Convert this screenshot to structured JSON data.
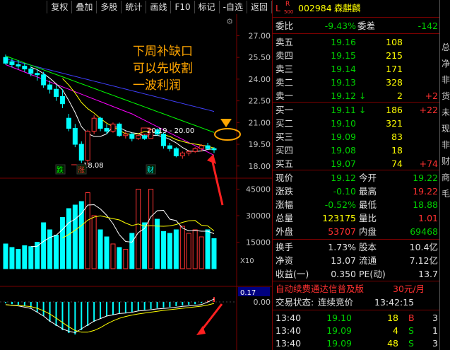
{
  "toolbar": {
    "items": [
      "复权",
      "叠加",
      "多股",
      "统计",
      "画线",
      "F10",
      "标记",
      "-自选",
      "返回"
    ]
  },
  "chart": {
    "price_axis": [
      "27.00",
      "25.50",
      "24.00",
      "22.50",
      "21.00",
      "19.50",
      "18.00"
    ],
    "vol_axis": [
      "45000",
      "30000",
      "15000"
    ],
    "vol_multiplier": "X10",
    "macd_axis": [
      "0.17",
      "0.00"
    ],
    "annotation": [
      "下周补缺口",
      "可以先收割",
      "一波利润"
    ],
    "label_gap": "20.19 - 20.00",
    "label_low": "18.08",
    "marks": [
      "跌",
      "涨",
      "财"
    ],
    "colors": {
      "up": "#ff3333",
      "down": "#00ffff",
      "ma5": "#ffffff",
      "ma10": "#ffff00",
      "ma20": "#ff00ff",
      "ma60": "#00ff00",
      "ma_blue": "#4040ff",
      "annotation": "#ffa500"
    }
  },
  "chart_data": {
    "type": "line",
    "candles": [
      {
        "o": 25.5,
        "h": 25.7,
        "l": 25.0,
        "c": 25.1
      },
      {
        "o": 25.2,
        "h": 25.4,
        "l": 24.8,
        "c": 25.0
      },
      {
        "o": 25.0,
        "h": 25.3,
        "l": 24.7,
        "c": 24.9
      },
      {
        "o": 24.9,
        "h": 25.1,
        "l": 24.5,
        "c": 24.7
      },
      {
        "o": 24.7,
        "h": 24.9,
        "l": 24.2,
        "c": 24.4
      },
      {
        "o": 24.4,
        "h": 24.7,
        "l": 23.9,
        "c": 24.3
      },
      {
        "o": 24.3,
        "h": 24.5,
        "l": 23.4,
        "c": 23.6
      },
      {
        "o": 23.6,
        "h": 23.9,
        "l": 23.0,
        "c": 23.3
      },
      {
        "o": 23.3,
        "h": 23.6,
        "l": 22.5,
        "c": 22.8
      },
      {
        "o": 22.8,
        "h": 23.3,
        "l": 22.0,
        "c": 22.3
      },
      {
        "o": 21.3,
        "h": 21.6,
        "l": 20.4,
        "c": 20.6
      },
      {
        "o": 20.6,
        "h": 20.9,
        "l": 19.3,
        "c": 19.5
      },
      {
        "o": 19.5,
        "h": 19.7,
        "l": 18.2,
        "c": 18.4
      },
      {
        "o": 18.4,
        "h": 20.5,
        "l": 18.1,
        "c": 20.4
      },
      {
        "o": 20.4,
        "h": 21.5,
        "l": 20.2,
        "c": 21.3
      },
      {
        "o": 21.3,
        "h": 21.4,
        "l": 20.4,
        "c": 20.6
      },
      {
        "o": 20.6,
        "h": 20.9,
        "l": 20.2,
        "c": 20.4
      },
      {
        "o": 20.4,
        "h": 21.0,
        "l": 20.3,
        "c": 20.9
      },
      {
        "o": 20.9,
        "h": 21.0,
        "l": 20.0,
        "c": 20.1
      },
      {
        "o": 20.1,
        "h": 20.4,
        "l": 19.9,
        "c": 20.2
      },
      {
        "o": 20.2,
        "h": 20.3,
        "l": 19.7,
        "c": 19.9
      },
      {
        "o": 19.9,
        "h": 20.2,
        "l": 19.8,
        "c": 20.1
      },
      {
        "o": 20.1,
        "h": 20.2,
        "l": 19.8,
        "c": 19.9
      },
      {
        "o": 19.9,
        "h": 20.6,
        "l": 19.9,
        "c": 20.5
      },
      {
        "o": 20.5,
        "h": 20.6,
        "l": 20.1,
        "c": 20.2
      },
      {
        "o": 20.2,
        "h": 20.3,
        "l": 19.2,
        "c": 19.4
      },
      {
        "o": 19.4,
        "h": 19.6,
        "l": 19.0,
        "c": 19.2
      },
      {
        "o": 19.2,
        "h": 19.3,
        "l": 18.6,
        "c": 18.7
      },
      {
        "o": 18.7,
        "h": 19.0,
        "l": 18.5,
        "c": 18.9
      },
      {
        "o": 18.9,
        "h": 19.1,
        "l": 18.7,
        "c": 19.0
      },
      {
        "o": 19.0,
        "h": 19.3,
        "l": 18.9,
        "c": 19.2
      },
      {
        "o": 19.2,
        "h": 19.5,
        "l": 19.0,
        "c": 19.4
      },
      {
        "o": 19.4,
        "h": 19.6,
        "l": 19.1,
        "c": 19.2
      },
      {
        "o": 19.2,
        "h": 19.3,
        "l": 18.9,
        "c": 19.12
      }
    ],
    "volume": [
      14000,
      12000,
      11000,
      13000,
      12500,
      15000,
      26000,
      22000,
      19000,
      29000,
      34000,
      36000,
      38000,
      43000,
      30000,
      22000,
      18000,
      14000,
      12000,
      11000,
      20000,
      45000,
      26000,
      45000,
      28000,
      21000,
      20000,
      22000,
      24000,
      20000,
      22000,
      18000,
      22000,
      17000
    ],
    "macd": [
      -0.05,
      -0.08,
      -0.1,
      -0.15,
      -0.2,
      -0.35,
      -0.5,
      -0.7,
      -0.85,
      -1.0,
      -1.1,
      -1.15,
      -1.0,
      -0.85,
      -0.7,
      -0.6,
      -0.5,
      -0.45,
      -0.4,
      -0.38,
      -0.35,
      -0.3,
      -0.28,
      -0.25,
      -0.22,
      -0.2,
      -0.18,
      -0.15,
      -0.12,
      -0.1,
      -0.08,
      -0.05,
      0.05,
      0.17
    ],
    "ylim": [
      17.5,
      28.0
    ]
  },
  "quote": {
    "header": {
      "L": "L",
      "R": "R",
      "sub": "500",
      "code": "002984",
      "name": "森麒麟"
    },
    "weibi": {
      "label": "委比",
      "pct": "-9.43%",
      "label2": "委差",
      "val": "-142"
    },
    "asks": [
      {
        "label": "卖五",
        "price": "19.16",
        "vol": "108",
        "chg": ""
      },
      {
        "label": "卖四",
        "price": "19.15",
        "vol": "215",
        "chg": ""
      },
      {
        "label": "卖三",
        "price": "19.14",
        "vol": "171",
        "chg": ""
      },
      {
        "label": "卖二",
        "price": "19.13",
        "vol": "328",
        "chg": ""
      },
      {
        "label": "卖一",
        "price": "19.12",
        "vol": "2",
        "chg": "+2"
      }
    ],
    "bids": [
      {
        "label": "买一",
        "price": "19.11",
        "vol": "186",
        "chg": "+22"
      },
      {
        "label": "买二",
        "price": "19.10",
        "vol": "321",
        "chg": ""
      },
      {
        "label": "买三",
        "price": "19.09",
        "vol": "83",
        "chg": ""
      },
      {
        "label": "买四",
        "price": "19.08",
        "vol": "18",
        "chg": ""
      },
      {
        "label": "买五",
        "price": "19.07",
        "vol": "74",
        "chg": "+74"
      }
    ],
    "stats": [
      {
        "l1": "现价",
        "v1": "19.12",
        "l2": "今开",
        "v2": "19.22"
      },
      {
        "l1": "涨跌",
        "v1": "-0.10",
        "l2": "最高",
        "v2": "19.22"
      },
      {
        "l1": "涨幅",
        "v1": "-0.52%",
        "l2": "最低",
        "v2": "18.88"
      },
      {
        "l1": "总量",
        "v1": "123175",
        "l2": "量比",
        "v2": "1.01"
      },
      {
        "l1": "外盘",
        "v1": "53707",
        "l2": "内盘",
        "v2": "69468"
      }
    ],
    "stats2": [
      {
        "l1": "换手",
        "v1": "1.73%",
        "l2": "股本",
        "v2": "10.4亿"
      },
      {
        "l1": "净资",
        "v1": "13.07",
        "l2": "流通",
        "v2": "7.12亿"
      },
      {
        "l1": "收益(一)",
        "v1": "0.350",
        "l2": "PE(动)",
        "v2": "13.7"
      }
    ],
    "promo": {
      "text": "自动续费通达信普及版",
      "price": "30元/月"
    },
    "trade_status": {
      "label": "交易状态:",
      "value": "连续竞价",
      "time": "13:42:15"
    },
    "ticks": [
      {
        "time": "13:40",
        "price": "19.10",
        "vol": "18",
        "bs": "B",
        "n": "3"
      },
      {
        "time": "13:40",
        "price": "19.09",
        "vol": "4",
        "bs": "S",
        "n": "1"
      },
      {
        "time": "13:40",
        "price": "19.09",
        "vol": "48",
        "bs": "S",
        "n": "3"
      }
    ]
  },
  "side": {
    "chars": [
      "总",
      "净",
      "非",
      "货",
      "未",
      "现",
      "非",
      "财",
      "商",
      "毛"
    ]
  }
}
